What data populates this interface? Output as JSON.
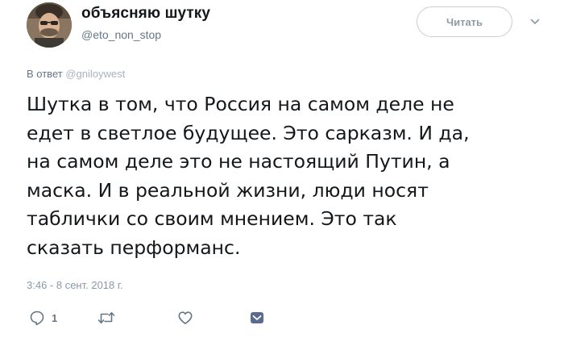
{
  "author": {
    "display_name": "объясняю шутку",
    "handle": "@eto_non_stop"
  },
  "follow_button": {
    "label": "Читать"
  },
  "reply_context": {
    "prefix": "В ответ",
    "user": "@gniloywest"
  },
  "tweet": {
    "lines": [
      "Шутка в том, что Россия на самом деле не",
      "едет в светлое будущее. Это сарказм. И да,",
      "на самом деле это не настоящий Путин, а",
      "маска. И в реальной жизни,  люди носят",
      "таблички со своим мнением. Это так",
      "сказать перформанс."
    ],
    "timestamp": "3:46 - 8 сент. 2018 г."
  },
  "actions": {
    "reply_count": "1",
    "icons": [
      "reply-icon",
      "retweet-icon",
      "like-icon",
      "direct-message-icon"
    ]
  },
  "colors": {
    "text": "#14171a",
    "secondary": "#657786",
    "border": "#c9ced3",
    "dm_icon": "#5b6c8c"
  }
}
